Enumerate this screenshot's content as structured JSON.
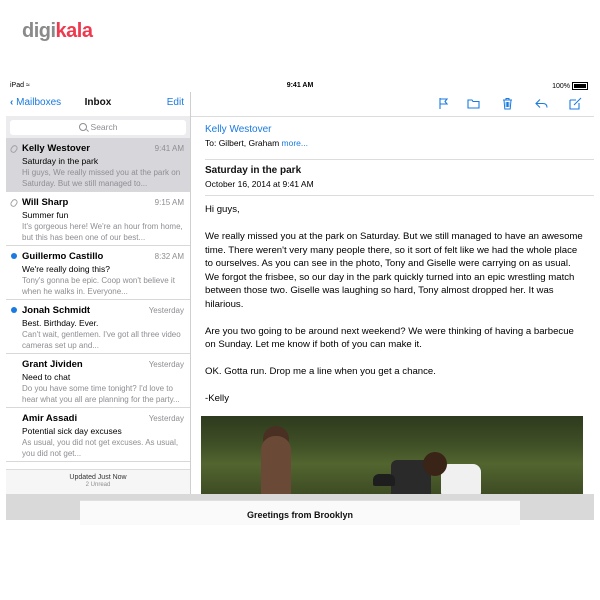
{
  "brand": {
    "part1": "digi",
    "part2": "kala",
    "color": "#ef394e"
  },
  "status_bar": {
    "device": "iPad",
    "time": "9:41 AM",
    "battery": "100%"
  },
  "sidebar": {
    "back_label": "Mailboxes",
    "title": "Inbox",
    "edit_label": "Edit",
    "search_placeholder": "Search",
    "messages": [
      {
        "from": "Kelly Westover",
        "time": "9:41 AM",
        "subject": "Saturday in the park",
        "preview": "Hi guys, We really missed you at the park on Saturday. But we still managed to...",
        "selected": true,
        "unread": false,
        "attachment": true
      },
      {
        "from": "Will Sharp",
        "time": "9:15 AM",
        "subject": "Summer fun",
        "preview": "It's gorgeous here! We're an hour from home, but this has been one of our best...",
        "selected": false,
        "unread": false,
        "attachment": true
      },
      {
        "from": "Guillermo Castillo",
        "time": "8:32 AM",
        "subject": "We're really doing this?",
        "preview": "Tony's gonna be epic. Coop won't believe it when he walks in. Everyone...",
        "selected": false,
        "unread": true,
        "attachment": false
      },
      {
        "from": "Jonah Schmidt",
        "time": "Yesterday",
        "subject": "Best. Birthday. Ever.",
        "preview": "Can't wait, gentlemen. I've got all three video cameras set up and...",
        "selected": false,
        "unread": true,
        "attachment": false
      },
      {
        "from": "Grant Jividen",
        "time": "Yesterday",
        "subject": "Need to chat",
        "preview": "Do you have some time tonight? I'd love to hear what you all are planning for the party...",
        "selected": false,
        "unread": false,
        "attachment": false
      },
      {
        "from": "Amir Assadi",
        "time": "Yesterday",
        "subject": "Potential sick day excuses",
        "preview": "As usual, you did not get excuses. As usual, you did not get...",
        "selected": false,
        "unread": false,
        "attachment": false
      }
    ],
    "footer_updated": "Updated Just Now",
    "footer_unread": "2 Unread"
  },
  "message": {
    "sender": "Kelly Westover",
    "to": "To: Gilbert, Graham",
    "more": "more...",
    "subject": "Saturday in the park",
    "date": "October 16, 2014 at 9:41 AM",
    "body": [
      "Hi guys,",
      "We really missed you at the park on Saturday. But we still managed to have an awesome time. There weren't very many people there, so it sort of felt like we had the whole place to ourselves. As you can see in the photo, Tony and Giselle were carrying on as usual. We forgot the frisbee, so our day in the park quickly turned into an epic wrestling match between those two. Giselle was laughing so hard, Tony almost dropped her. It was hilarious.",
      "Are you two going to be around next weekend? We were thinking of having a barbecue on Sunday. Let me know if both of you can make it.",
      "OK. Gotta run. Drop me a line when you get a chance.",
      "-Kelly"
    ]
  },
  "toolbar_icons": [
    "flag-icon",
    "folder-icon",
    "trash-icon",
    "reply-icon",
    "compose-icon"
  ],
  "accent_color": "#1a7ae0",
  "compose_bar": {
    "title": "Greetings from Brooklyn"
  }
}
